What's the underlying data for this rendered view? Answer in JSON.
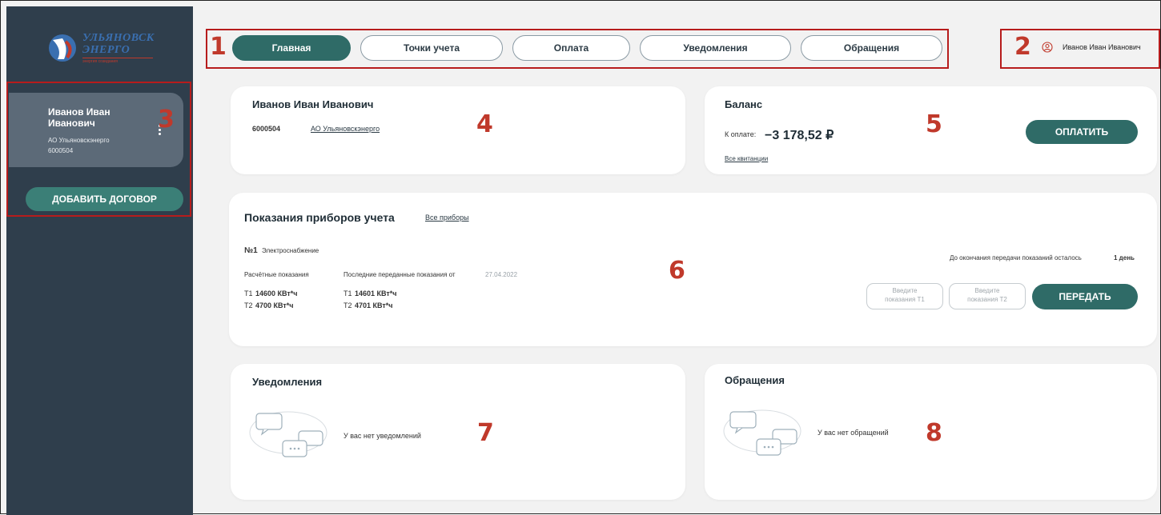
{
  "brand": {
    "line1": "УЛЬЯНОВСК",
    "line2": "ЭНЕРГО",
    "tagline": "энергия созидания"
  },
  "sidebar": {
    "contract": {
      "name": "Иванов Иван Иванович",
      "org": "АО Ульяновскэнерго",
      "number": "6000504"
    },
    "add_contract_label": "ДОБАВИТЬ ДОГОВОР"
  },
  "nav": {
    "tabs": [
      {
        "label": "Главная",
        "active": true
      },
      {
        "label": "Точки учета",
        "active": false
      },
      {
        "label": "Оплата",
        "active": false
      },
      {
        "label": "Уведомления",
        "active": false
      },
      {
        "label": "Обращения",
        "active": false
      }
    ]
  },
  "header": {
    "user_name": "Иванов Иван Иванович"
  },
  "account_card": {
    "name": "Иванов Иван Иванович",
    "number": "6000504",
    "org_link": "АО Ульяновскэнерго"
  },
  "balance_card": {
    "title": "Баланс",
    "due_label": "К оплате:",
    "due_amount": "−3 178,52 ₽",
    "receipts_link": "Все квитанции",
    "pay_label": "ОПЛАТИТЬ"
  },
  "meters_card": {
    "title": "Показания приборов учета",
    "all_link": "Все приборы",
    "meter_no": "№1",
    "meter_type": "Электроснабжение",
    "deadline_text": "До окончания передачи показаний осталось",
    "deadline_value": "1 день",
    "calc_header": "Расчётные показания",
    "last_header": "Последние переданные показания от",
    "last_date": "27.04.2022",
    "calc": [
      {
        "tariff": "Т1",
        "value": "14600 КВт*ч"
      },
      {
        "tariff": "Т2",
        "value": "4700 КВт*ч"
      }
    ],
    "last": [
      {
        "tariff": "Т1",
        "value": "14601 КВт*ч"
      },
      {
        "tariff": "Т2",
        "value": "4701 КВт*ч"
      }
    ],
    "input_t1_line1": "Введите",
    "input_t1_line2": "показания Т1",
    "input_t2_line1": "Введите",
    "input_t2_line2": "показания Т2",
    "send_label": "ПЕРЕДАТЬ"
  },
  "notifications_card": {
    "title": "Уведомления",
    "empty_text": "У вас нет уведомлений"
  },
  "requests_card": {
    "title": "Обращения",
    "empty_text": "У вас нет обращений"
  },
  "annotations": [
    "1",
    "2",
    "3",
    "4",
    "5",
    "6",
    "7",
    "8"
  ],
  "colors": {
    "sidebar_bg": "#2f3e4c",
    "accent": "#2f6b67",
    "annotation": "#c0392b"
  }
}
